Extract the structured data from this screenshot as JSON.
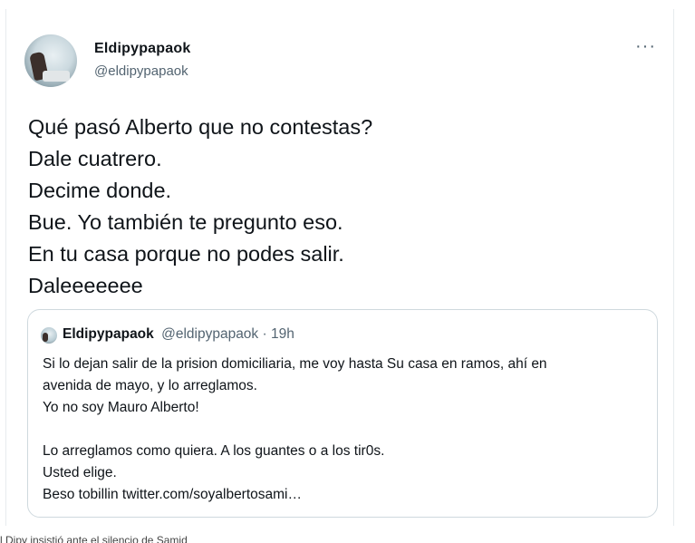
{
  "tweet": {
    "name": "Eldipypapaok",
    "handle": "@eldipypapaok",
    "more_icon": "···",
    "lines": [
      "Qué pasó Alberto que no contestas?",
      "Dale cuatrero.",
      "Decime donde.",
      "Bue. Yo también te pregunto eso.",
      "En tu casa porque no podes salir.",
      "Daleeeeeee"
    ]
  },
  "quote": {
    "name": "Eldipypapaok",
    "handle_time": "@eldipypapaok · 19h",
    "lines": [
      "Si lo dejan salir de la prision domiciliaria, me voy hasta Su casa en ramos, ahí en",
      "avenida de mayo, y lo arreglamos.",
      "Yo no soy Mauro Alberto!",
      "",
      "Lo arreglamos como quiera. A los guantes o a los tir0s.",
      "Usted elige.",
      "Beso tobillin twitter.com/soyalbertosami…"
    ]
  },
  "caption": "l Dipy insistió ante el silencio de Samid"
}
